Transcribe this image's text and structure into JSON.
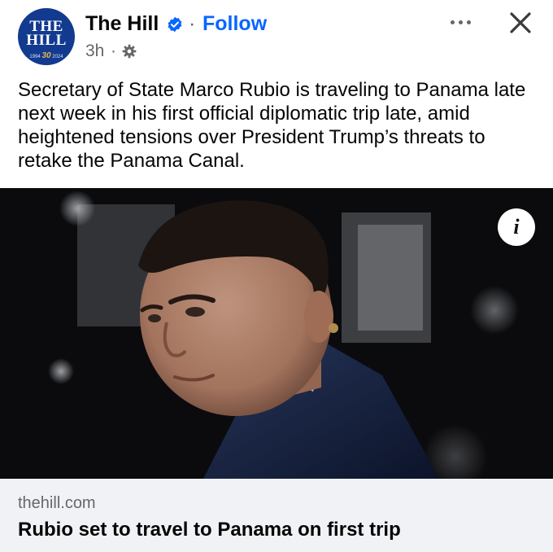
{
  "post": {
    "page_name": "The Hill",
    "follow_label": "Follow",
    "separator": "·",
    "time": "3h",
    "meta_separator": "·",
    "text": "Secretary of State Marco Rubio is traveling to Panama late next week in his first official diplomatic trip late, amid heightened tensions over President Trump’s threats to retake the Panama Canal."
  },
  "avatar": {
    "logo_line1": "THE",
    "logo_line2": "HILL",
    "logo_years_left": "1994",
    "logo_anniversary": "30",
    "logo_years_right": "2024"
  },
  "icons": {
    "verified": "verified-badge-icon",
    "audience": "gear-icon",
    "more": "more-options-icon",
    "close": "close-icon",
    "info": "info-icon"
  },
  "photo": {
    "info_glyph": "i"
  },
  "link_preview": {
    "domain": "thehill.com",
    "headline": "Rubio set to travel to Panama on first trip"
  },
  "colors": {
    "brand_blue": "#0866ff",
    "avatar_navy": "#123a8f",
    "secondary_text": "#65676b",
    "card_background": "#f0f2f5"
  }
}
